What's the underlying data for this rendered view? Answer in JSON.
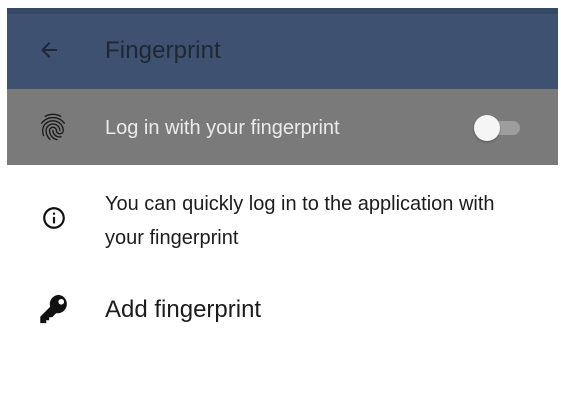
{
  "appbar": {
    "title": "Fingerprint",
    "back_icon": "arrow-left-icon",
    "background": "#3e5170"
  },
  "fingerprint_login": {
    "label": "Log in with your fingerprint",
    "icon": "fingerprint-icon",
    "enabled": false,
    "row_background": "#7a7a7a"
  },
  "info": {
    "icon": "info-icon",
    "text": "You can quickly log in to the application with your fingerprint"
  },
  "add_fingerprint": {
    "icon": "key-icon",
    "label": "Add fingerprint"
  }
}
